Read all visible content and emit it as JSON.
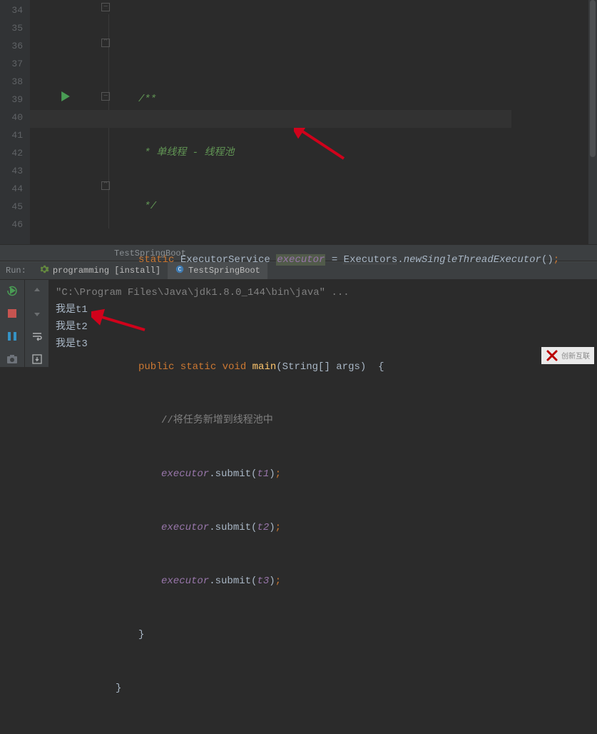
{
  "gutter": {
    "lines": [
      "34",
      "35",
      "36",
      "37",
      "38",
      "39",
      "40",
      "41",
      "42",
      "43",
      "44",
      "45",
      "46"
    ]
  },
  "code": {
    "l34": "/**",
    "l35_star": " * ",
    "l35_text": "单线程 - 线程池",
    "l36": " */",
    "l37_kw": "static ",
    "l37_type": "ExecutorService ",
    "l37_var": "executor",
    "l37_eq": " = ",
    "l37_cls": "Executors",
    "l37_dot": ".",
    "l37_method": "newSingleThreadExecutor",
    "l37_paren": "()",
    "l37_semi": ";",
    "l39_kw": "public static void ",
    "l39_name": "main",
    "l39_params": "(String[] args)  {",
    "l40_comment": "//将任务新增到线程池中",
    "l41_exec": "executor",
    "l41_call": ".submit(",
    "l41_arg": "t1",
    "l41_end": ")",
    "l41_semi": ";",
    "l42_exec": "executor",
    "l42_call": ".submit(",
    "l42_arg": "t2",
    "l42_end": ")",
    "l42_semi": ";",
    "l43_exec": "executor",
    "l43_call": ".submit(",
    "l43_arg": "t3",
    "l43_end": ")",
    "l43_semi": ";",
    "l44": "}",
    "l45": "}"
  },
  "breadcrumb": {
    "text": "TestSpringBoot"
  },
  "run_header": {
    "label": "Run:",
    "tab1_icon": "gear-icon",
    "tab1_text": "programming [install]",
    "tab2_icon": "class-icon",
    "tab2_text": "TestSpringBoot"
  },
  "console": {
    "cmd": "\"C:\\Program Files\\Java\\jdk1.8.0_144\\bin\\java\" ...",
    "line1": "我是t1",
    "line2": "我是t2",
    "line3": "我是t3"
  },
  "watermark": {
    "text": "创新互联"
  },
  "colors": {
    "bg": "#2b2b2b",
    "gutter": "#313335",
    "keyword": "#cc7832",
    "comment": "#629755",
    "field": "#9876aa",
    "method": "#ffc66d",
    "run_green": "#499c54",
    "run_red": "#c75450",
    "pause_blue": "#3592c4"
  }
}
